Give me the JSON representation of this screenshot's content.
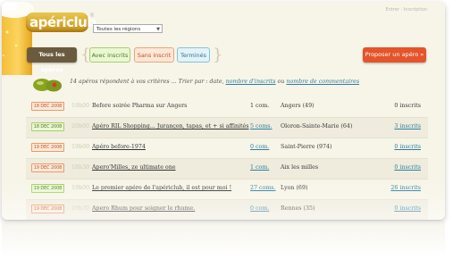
{
  "brand": {
    "name": "apériclub",
    "mark": "®"
  },
  "top_links": "Entrer · Inscription",
  "region_select": {
    "value": "Toutes les régions"
  },
  "tabs": [
    {
      "label": "Tous les apéros"
    },
    {
      "label": "Avec inscrits"
    },
    {
      "label": "Sans inscrit"
    },
    {
      "label": "Terminés"
    }
  ],
  "propose_button": "Proposer un apéro »",
  "sort": {
    "text": "14 apéros répondent à vos critères ... Trier par : date, ",
    "link1": "nombre d'inscrits",
    "mid": " ou ",
    "link2": "nombre de commentaires"
  },
  "rows": [
    {
      "date": "18 DEC 2008",
      "time": "19h00",
      "title": "Before soirée Pharma sur Angers",
      "comments": "1 com.",
      "city": "Angers (49)",
      "registered": "0 inscrits"
    },
    {
      "date": "18 DEC 2008",
      "time": "20h00",
      "title": "Apéro RIL Shopping... Jurançon, tapas, et + si affinités",
      "comments": "5 coms.",
      "city": "Oloron-Sainte-Marie (64)",
      "registered": "3 inscrits"
    },
    {
      "date": "19 DEC 2008",
      "time": "19h00",
      "title": "Apéro before-1974",
      "comments": "0 com.",
      "city": "Saint-Pierre (974)",
      "registered": "0 inscrits"
    },
    {
      "date": "19 DEC 2008",
      "time": "18h30",
      "title": "Apero'Milles, ze ultimate one",
      "comments": "1 com.",
      "city": "Aix les milles",
      "registered": "0 inscrits"
    },
    {
      "date": "19 DEC 2008",
      "time": "19h00",
      "title": "Le premier apéro de l'apériclub, il est pour moi !",
      "comments": "27 coms.",
      "city": "Lyon (69)",
      "registered": "26 inscrits"
    },
    {
      "date": "19 DEC 2008",
      "time": "19h30",
      "title": "Apero Rhum pour soigner le rhume.",
      "comments": "0 com.",
      "city": "Rennes (35)",
      "registered": "0 inscrits"
    }
  ],
  "colors": {
    "accent_orange": "#e5542a",
    "tab_dark": "#6b5b3e",
    "link_blue": "#2f7ea0",
    "date_green": "#a7cf6a",
    "date_orange": "#e99a6c"
  }
}
